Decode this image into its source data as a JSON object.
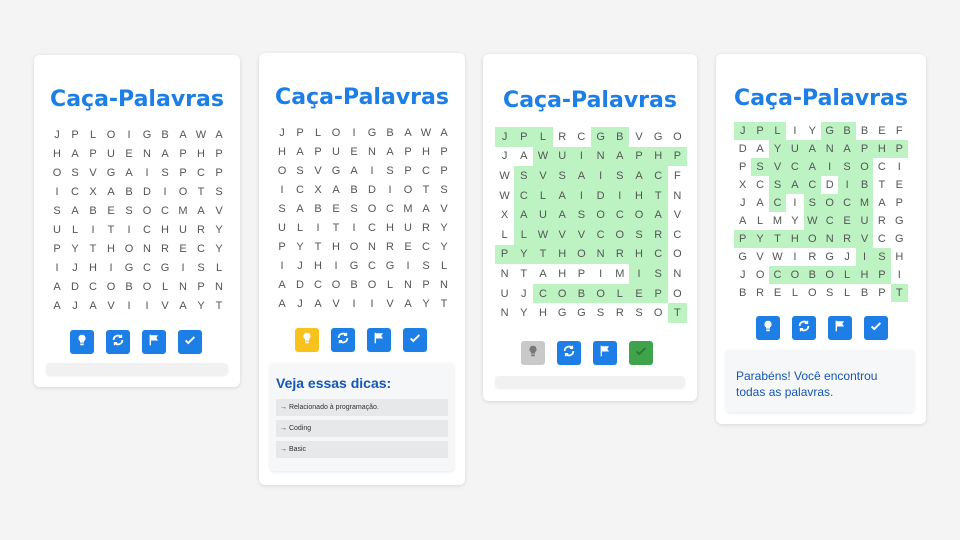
{
  "colors": {
    "accent": "#1d7ee6",
    "highlight": "#bdf3c3",
    "hint_button": "#f7c21e",
    "disabled_button": "#c9c9c9",
    "done_button": "#3ea34a"
  },
  "icons": {
    "hint": "lightbulb-icon",
    "reset": "refresh-icon",
    "reveal": "flag-icon",
    "check": "checkmark-icon"
  },
  "cards": [
    {
      "title": "Caça-Palavras",
      "state": "initial",
      "grid": [
        "JPLOIGBAWA",
        "HAPUENAPHP",
        "OSVGAISPCP",
        "ICXABDIOTS",
        "SABESOCMAV",
        "ULITICHURY",
        "PYTHONRECY",
        "IJHIGCGISL",
        "ADCOBOLNPN",
        "AJAVIIVAYT"
      ]
    },
    {
      "title": "Caça-Palavras",
      "state": "hints",
      "grid": [
        "JPLOIGBAWA",
        "HAPUENAPHP",
        "OSVGAISPCP",
        "ICXABDIOTS",
        "SABESOCMAV",
        "ULITICHURY",
        "PYTHONRECY",
        "IJHIGCGISL",
        "ADCOBOLNPN",
        "AJAVIIVAYT"
      ],
      "hints_title": "Veja essas dicas:",
      "hints": [
        "→ Relacionado à programação.",
        "→ Coding",
        "→ Basic"
      ]
    },
    {
      "title": "Caça-Palavras",
      "state": "revealed",
      "grid": [
        "JPLRCGBVGO",
        "JAWUINAPHP",
        "WSVSAISACF",
        "WCLAIDIHTN",
        "XAUASOCOAV",
        "LLWVVCOSRC",
        "PYTHONRHCO",
        "NTAHPIMISN",
        "UJCOBOLEPO",
        "NYHGGSRSOT"
      ]
    },
    {
      "title": "Caça-Palavras",
      "state": "solved",
      "grid": [
        "JPLIYGBBEF",
        "DAYUANAPHP",
        "PSVCAISOCI",
        "XCSACDIBTE",
        "JACISOCMAP",
        "ALMYWCEURG",
        "PYTHONRVCG",
        "GVWIRGJISH",
        "JOCOBOLHPI",
        "BRELOSLBPT"
      ],
      "success_message": "Parabéns! Você encontrou todas as palavras."
    }
  ]
}
